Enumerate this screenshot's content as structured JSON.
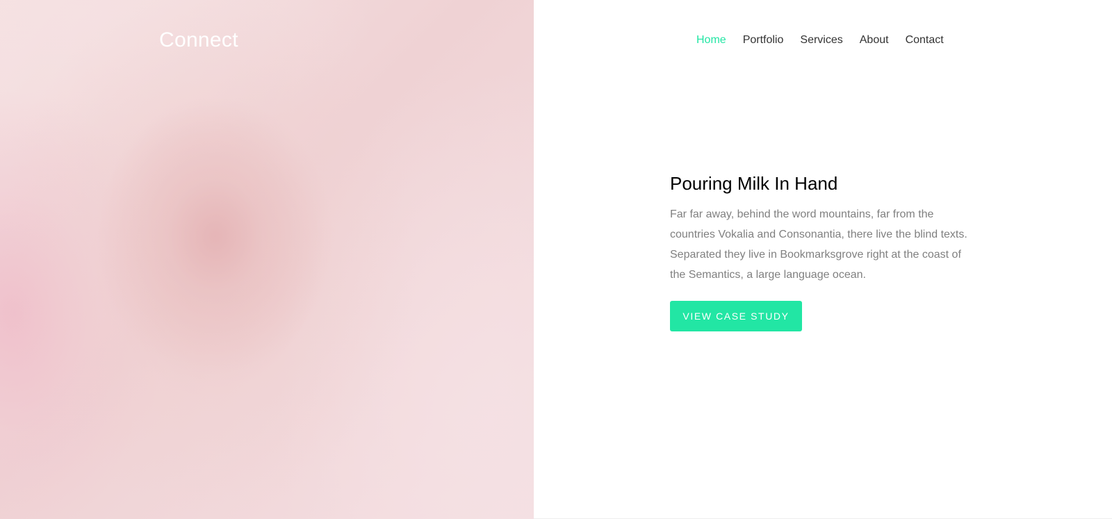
{
  "brand": {
    "name": "Connect"
  },
  "nav": {
    "items": [
      {
        "label": "Home",
        "active": true
      },
      {
        "label": "Portfolio",
        "active": false
      },
      {
        "label": "Services",
        "active": false
      },
      {
        "label": "About",
        "active": false
      },
      {
        "label": "Contact",
        "active": false
      }
    ]
  },
  "hero": {
    "image_description_icon": "hero-image",
    "title": "Pouring Milk In Hand",
    "body": "Far far away, behind the word mountains, far from the countries Vokalia and Consonantia, there live the blind texts. Separated they live in Bookmarksgrove right at the coast of the Semantics, a large language ocean.",
    "cta_label": "VIEW CASE STUDY"
  },
  "colors": {
    "accent": "#22e6a4",
    "nav_text": "#333333",
    "heading": "#000000",
    "body_text": "#808080",
    "hero_bg": "#f3dfe1"
  }
}
